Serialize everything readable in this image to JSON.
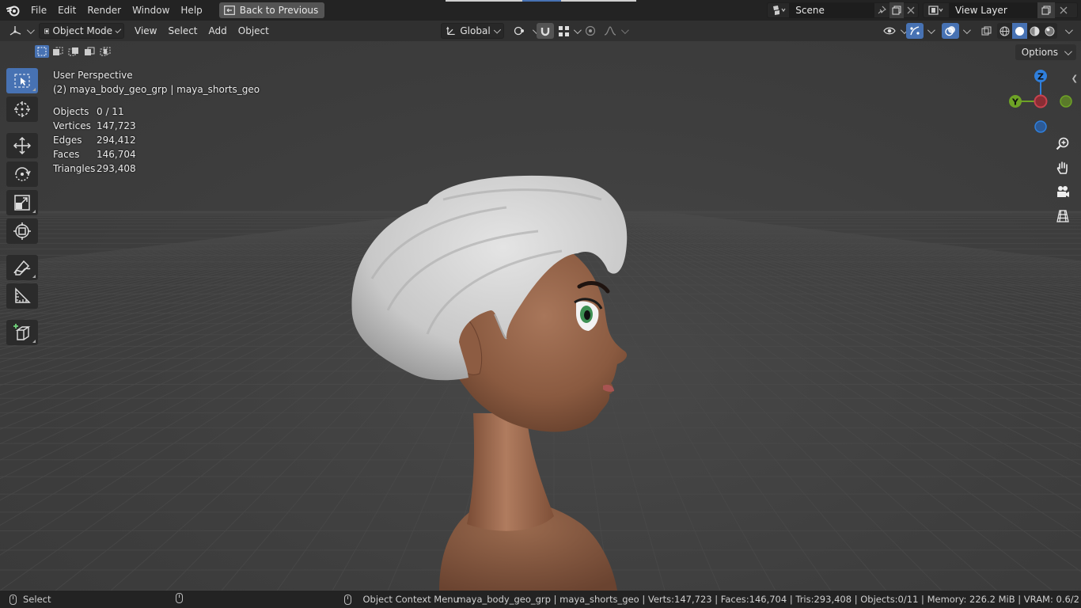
{
  "topbar": {
    "menus": [
      "File",
      "Edit",
      "Render",
      "Window",
      "Help"
    ],
    "back_button": "Back to Previous",
    "scene": {
      "value": "Scene",
      "icon": "scene-icon"
    },
    "view_layer": {
      "value": "View Layer",
      "icon": "view-layer-icon"
    }
  },
  "header": {
    "editor_type_icon": "3d-viewport-icon",
    "mode": "Object Mode",
    "menus": [
      "View",
      "Select",
      "Add",
      "Object"
    ],
    "orientation": "Global",
    "options_label": "Options"
  },
  "toolbar": {
    "tools": [
      {
        "name": "select-box",
        "icon": "select-box-icon",
        "active": true
      },
      {
        "name": "cursor",
        "icon": "cursor-icon",
        "active": false
      },
      {
        "name": "move",
        "icon": "move-icon",
        "active": false
      },
      {
        "name": "rotate",
        "icon": "rotate-icon",
        "active": false
      },
      {
        "name": "scale",
        "icon": "scale-icon",
        "active": false
      },
      {
        "name": "transform",
        "icon": "transform-icon",
        "active": false
      },
      {
        "name": "annotate",
        "icon": "annotate-icon",
        "active": false
      },
      {
        "name": "measure",
        "icon": "measure-icon",
        "active": false
      },
      {
        "name": "add-cube",
        "icon": "add-cube-icon",
        "active": false
      }
    ]
  },
  "viewport": {
    "view_name": "User Perspective",
    "active_object": "(2) maya_body_geo_grp | maya_shorts_geo",
    "stats": [
      {
        "label": "Objects",
        "value": "0 / 11"
      },
      {
        "label": "Vertices",
        "value": "147,723"
      },
      {
        "label": "Edges",
        "value": "294,412"
      },
      {
        "label": "Faces",
        "value": "146,704"
      },
      {
        "label": "Triangles",
        "value": "293,408"
      }
    ],
    "gizmo": {
      "z": "Z",
      "y": "Y"
    }
  },
  "statusbar": {
    "left_action": "Select",
    "mid_action": "Object Context Menu",
    "info": "maya_body_geo_grp | maya_shorts_geo | Verts:147,723 | Faces:146,704 | Tris:293,408 | Objects:0/11 | Memory: 226.2 MiB | VRAM: 0.6/2"
  },
  "colors": {
    "accent": "#4772b3",
    "axis_x": "#c8424e",
    "axis_y": "#6ea326",
    "axis_z": "#2f7fdc"
  }
}
